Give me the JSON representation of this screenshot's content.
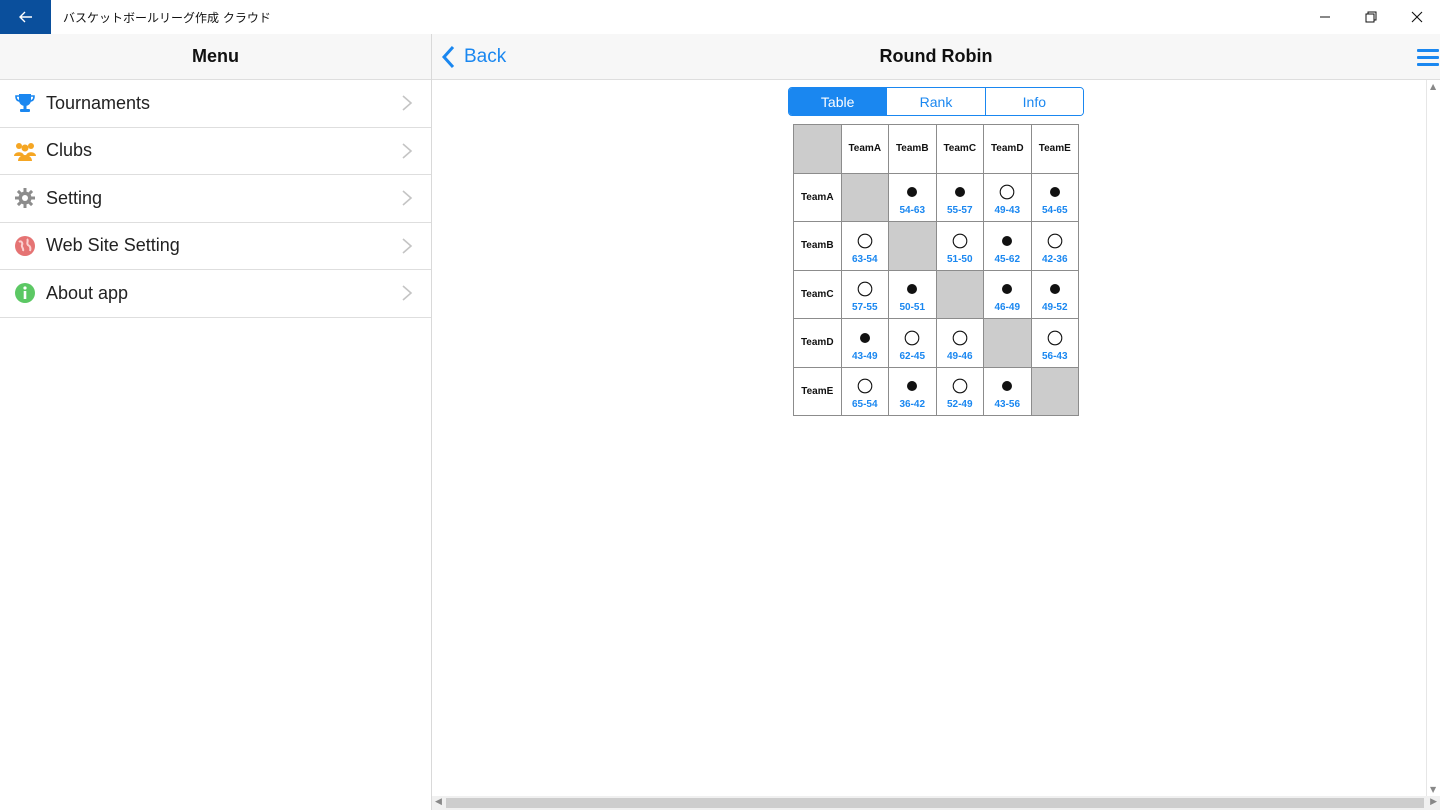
{
  "window": {
    "title": "バスケットボールリーグ作成 クラウド",
    "back_icon": "arrow-left-icon",
    "controls": [
      "minimize-icon",
      "restore-icon",
      "close-icon"
    ]
  },
  "menu": {
    "header": "Menu",
    "items": [
      {
        "label": "Tournaments",
        "icon": "trophy-icon",
        "icon_color": "#1a87f0"
      },
      {
        "label": "Clubs",
        "icon": "people-icon",
        "icon_color": "#f5a623"
      },
      {
        "label": "Setting",
        "icon": "gear-icon",
        "icon_color": "#8c8c8c"
      },
      {
        "label": "Web Site Setting",
        "icon": "globe-icon",
        "icon_color": "#e57373"
      },
      {
        "label": "About app",
        "icon": "info-icon",
        "icon_color": "#5cc864"
      }
    ]
  },
  "nav": {
    "back_label": "Back",
    "title": "Round Robin",
    "menu_icon": "hamburger-icon"
  },
  "tabs": [
    {
      "label": "Table",
      "active": true
    },
    {
      "label": "Rank",
      "active": false
    },
    {
      "label": "Info",
      "active": false
    }
  ],
  "round_robin": {
    "teams": [
      "TeamA",
      "TeamB",
      "TeamC",
      "TeamD",
      "TeamE"
    ],
    "rows": [
      {
        "team": "TeamA",
        "cells": [
          null,
          {
            "result": "loss",
            "score": "54-63"
          },
          {
            "result": "loss",
            "score": "55-57"
          },
          {
            "result": "win",
            "score": "49-43"
          },
          {
            "result": "loss",
            "score": "54-65"
          }
        ]
      },
      {
        "team": "TeamB",
        "cells": [
          {
            "result": "win",
            "score": "63-54"
          },
          null,
          {
            "result": "win",
            "score": "51-50"
          },
          {
            "result": "loss",
            "score": "45-62"
          },
          {
            "result": "win",
            "score": "42-36"
          }
        ]
      },
      {
        "team": "TeamC",
        "cells": [
          {
            "result": "win",
            "score": "57-55"
          },
          {
            "result": "loss",
            "score": "50-51"
          },
          null,
          {
            "result": "loss",
            "score": "46-49"
          },
          {
            "result": "loss",
            "score": "49-52"
          }
        ]
      },
      {
        "team": "TeamD",
        "cells": [
          {
            "result": "loss",
            "score": "43-49"
          },
          {
            "result": "win",
            "score": "62-45"
          },
          {
            "result": "win",
            "score": "49-46"
          },
          null,
          {
            "result": "win",
            "score": "56-43"
          }
        ]
      },
      {
        "team": "TeamE",
        "cells": [
          {
            "result": "win",
            "score": "65-54"
          },
          {
            "result": "loss",
            "score": "36-42"
          },
          {
            "result": "win",
            "score": "52-49"
          },
          {
            "result": "loss",
            "score": "43-56"
          },
          null
        ]
      }
    ]
  },
  "colors": {
    "accent": "#1a87f0",
    "title_bar_back": "#0a4f9c",
    "diagonal_cell": "#cccccc"
  }
}
